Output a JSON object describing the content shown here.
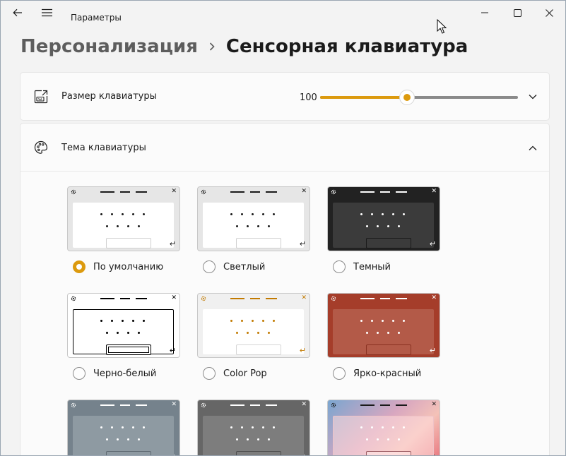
{
  "window": {
    "title": "Параметры"
  },
  "titlebar": {
    "back_icon": "back-arrow-icon",
    "menu_icon": "hamburger-menu-icon"
  },
  "breadcrumb": {
    "parent": "Персонализация",
    "separator_icon": "chevron-right-icon",
    "current": "Сенсорная клавиатура"
  },
  "keyboard_size": {
    "label": "Размер клавиатуры",
    "value": "100",
    "slider_fraction": 0.44,
    "icon": "keyboard-resize-icon"
  },
  "keyboard_theme": {
    "label": "Тема клавиатуры",
    "icon": "palette-icon",
    "themes": [
      {
        "name": "По умолчанию",
        "selected": true,
        "frame": "#e6e6e6",
        "body": "#ffffff",
        "body_border": "#ffffff",
        "key": "#1b1b1b",
        "space_border": "#d0d0d0",
        "bars": "#1b1b1b"
      },
      {
        "name": "Светлый",
        "selected": false,
        "frame": "#e6e6e6",
        "body": "#ffffff",
        "body_border": "#ffffff",
        "key": "#1b1b1b",
        "space_border": "#d0d0d0",
        "bars": "#1b1b1b"
      },
      {
        "name": "Темный",
        "selected": false,
        "frame": "#222222",
        "body": "#3b3b3b",
        "body_border": "#3b3b3b",
        "key": "#ffffff",
        "space_border": "#1a1a1a",
        "bars": "#ffffff"
      },
      {
        "name": "Черно-белый",
        "selected": false,
        "frame": "#ffffff",
        "body": "#ffffff",
        "body_border": "#000000",
        "key": "#000000",
        "space_border": "#000000",
        "bars": "#000000"
      },
      {
        "name": "Color Pop",
        "selected": false,
        "frame": "#f0f0f0",
        "body": "#ffffff",
        "body_border": "#ffffff",
        "key": "#c27a00",
        "space_border": "#d6d6d6",
        "bars": "#c27a00"
      },
      {
        "name": "Ярко-красный",
        "selected": false,
        "frame": "#a53d2a",
        "body": "#b35a48",
        "body_border": "#b35a48",
        "key": "#ffffff",
        "space_border": "#8a3222",
        "bars": "#ffffff"
      },
      {
        "name": "",
        "selected": false,
        "frame": "#75828c",
        "body": "#8e9aa2",
        "body_border": "#8e9aa2",
        "key": "#ffffff",
        "space_border": "#5f6a72",
        "bars": "#ffffff"
      },
      {
        "name": "",
        "selected": false,
        "frame": "#666666",
        "body": "#7d7d7d",
        "body_border": "#7d7d7d",
        "key": "#ffffff",
        "space_border": "#4e4e4e",
        "bars": "#ffffff"
      },
      {
        "name": "",
        "selected": false,
        "frame": "#c9a4b8",
        "body": "#efc2c6",
        "body_border": "#efc2c6",
        "key": "#ffffff",
        "space_border": "#9a5a60",
        "bars": "#1b1b1b"
      }
    ]
  },
  "colors": {
    "accent": "#dc9a0e",
    "background": "#f3f3f3",
    "card": "#fbfbfb"
  }
}
